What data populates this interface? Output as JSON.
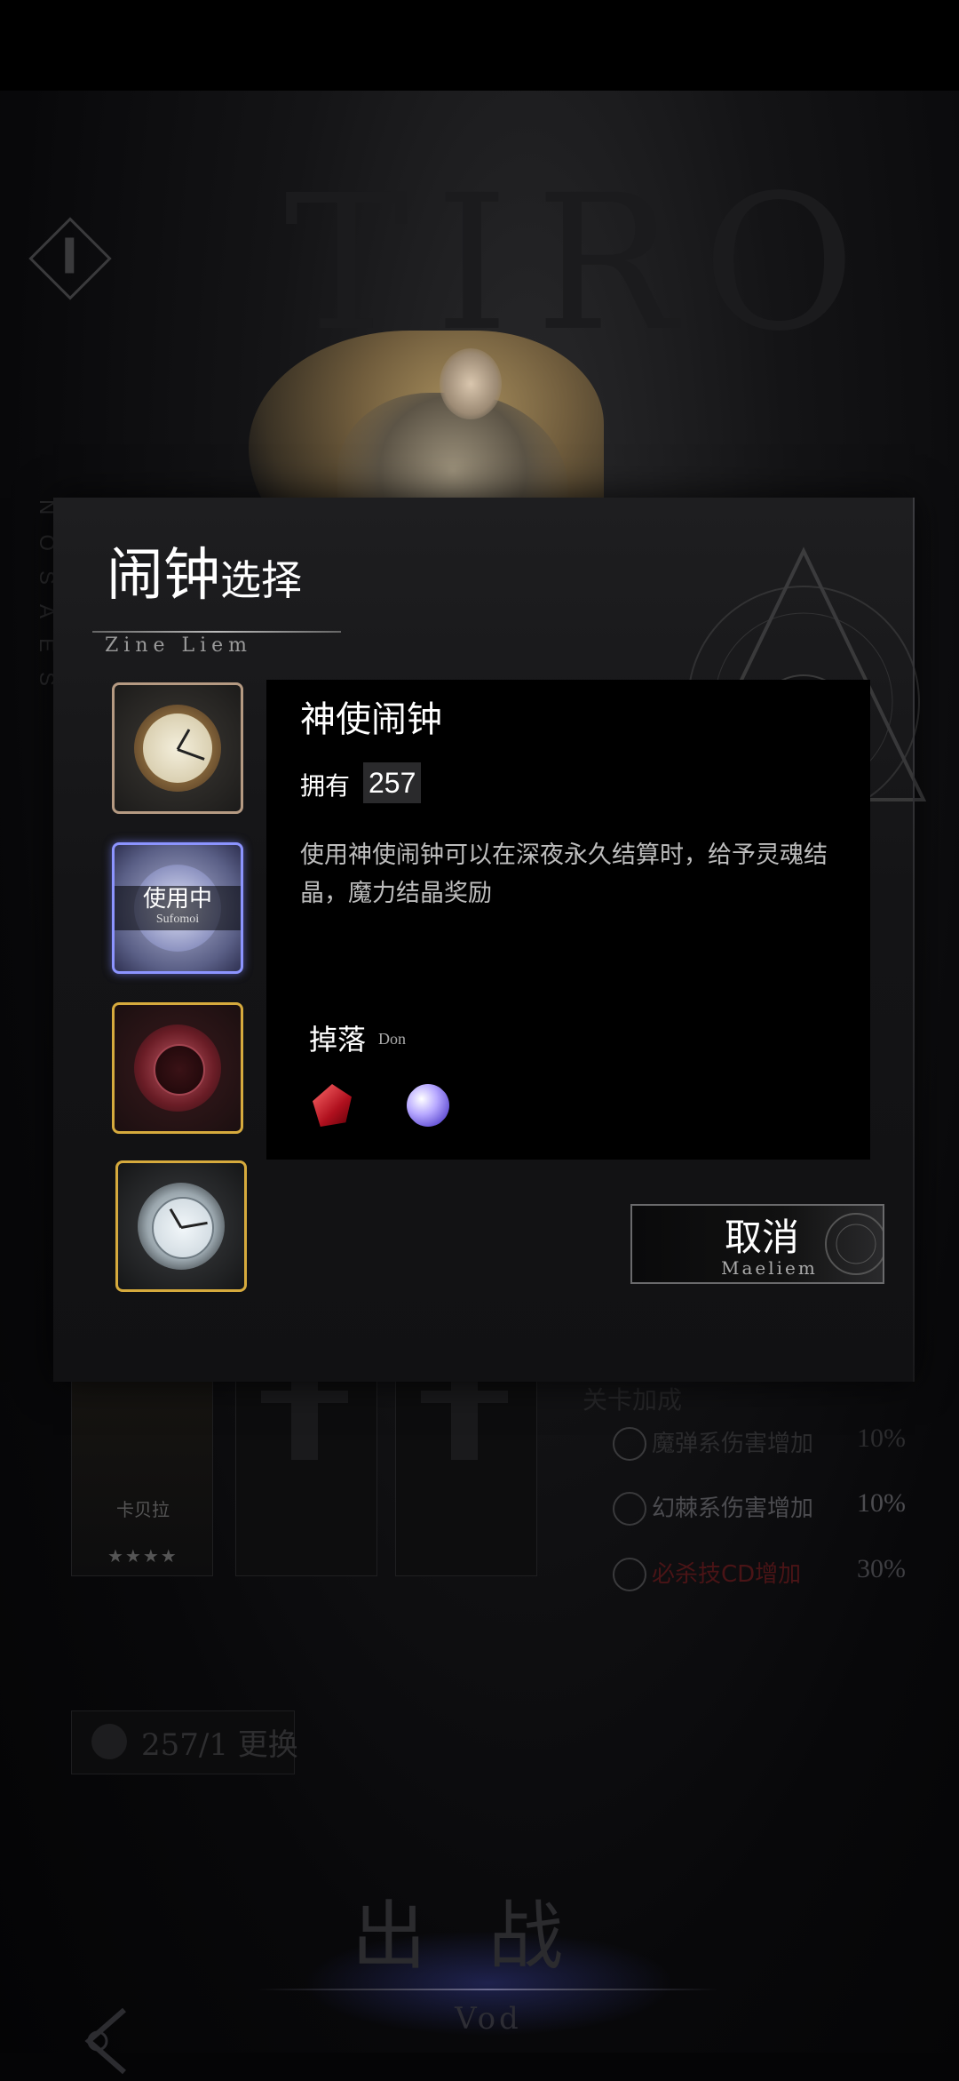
{
  "background": {
    "letters": "TIRO",
    "season_text": "NOSAES",
    "team_card_name": "卡贝拉",
    "team_card_stars": "★★★★",
    "buffs_title": "关卡加成",
    "buffs": [
      {
        "name": "魔弹系伤害增加",
        "value": "10%",
        "color": "#2c2c2e",
        "icon": "bullet-icon"
      },
      {
        "name": "幻棘系伤害增加",
        "value": "10%",
        "color": "#4c4c50",
        "icon": "thorn-icon"
      },
      {
        "name": "必杀技CD增加",
        "value": "30%",
        "color": "#4a1416",
        "icon": "clock-icon"
      }
    ],
    "swap_text": "257/1 更换",
    "sortie_main": "出战",
    "sortie_sub": "Vod"
  },
  "modal": {
    "title_big": "闹钟",
    "title_small": "选择",
    "title_sub": "Zine Liem",
    "slots": [
      {
        "icon": "gold-pocket-watch-icon",
        "status": ""
      },
      {
        "icon": "winged-watch-icon",
        "status": "使用中",
        "status_sub": "Sufomoi"
      },
      {
        "icon": "crimson-watch-icon",
        "status": ""
      },
      {
        "icon": "jeweled-watch-icon",
        "status": ""
      }
    ],
    "detail": {
      "name": "神使闹钟",
      "own_label": "拥有",
      "own_count": "257",
      "description": "使用神使闹钟可以在深夜永久结算时，给予灵魂结晶，魔力结晶奖励",
      "drop_label": "掉落",
      "drop_sub": "Don",
      "drops": [
        "red-crystal-icon",
        "blue-crystal-icon"
      ]
    },
    "cancel_main": "取消",
    "cancel_sub": "Maeliem"
  }
}
